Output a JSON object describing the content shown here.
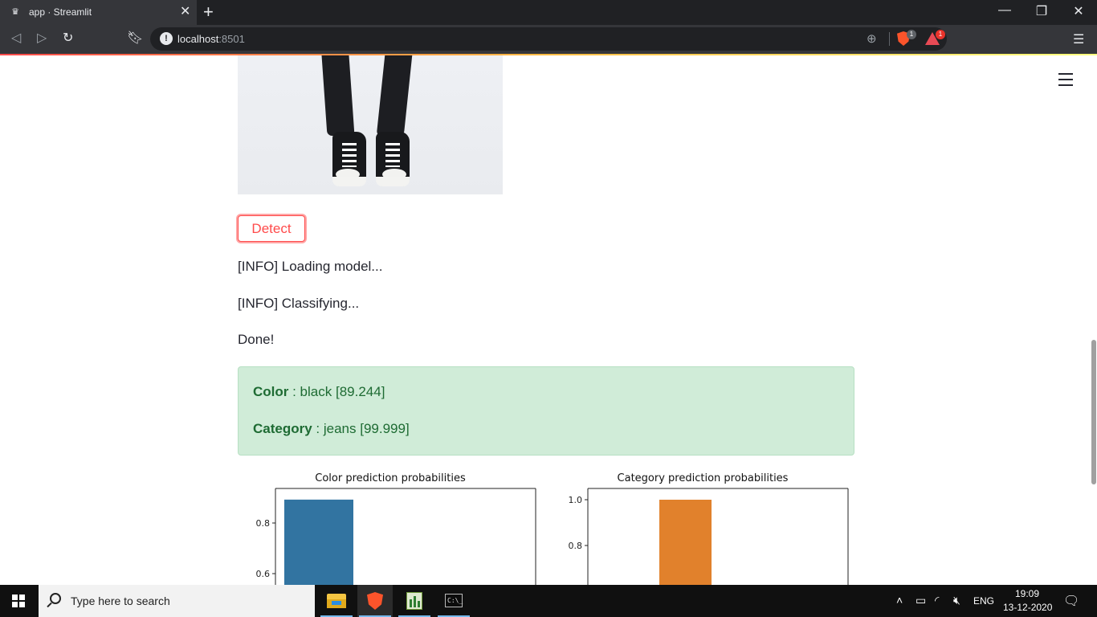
{
  "browser": {
    "tab_title": "app · Streamlit",
    "tab_favicon": "streamlit-crown-icon",
    "url_host": "localhost",
    "url_port": ":8501",
    "shield_badge": "1",
    "rewards_badge": "1"
  },
  "main": {
    "detect_label": "Detect",
    "log": [
      "[INFO] Loading model...",
      "[INFO] Classifying...",
      "Done!"
    ],
    "result": {
      "color_key": "Color",
      "color_value": " : black [89.244]",
      "category_key": "Category",
      "category_value": " : jeans [99.999]"
    }
  },
  "chart_data": [
    {
      "type": "bar",
      "title": "Color prediction probabilities",
      "y_ticks": [
        "0.8",
        "0.6"
      ],
      "values": [
        0.89244
      ],
      "color": "#3274a1"
    },
    {
      "type": "bar",
      "title": "Category prediction probabilities",
      "y_ticks": [
        "1.0",
        "0.8"
      ],
      "values": [
        0.99999
      ],
      "color": "#e1812c"
    }
  ],
  "taskbar": {
    "search_placeholder": "Type here to search",
    "language": "ENG",
    "time": "19:09",
    "date": "13-12-2020"
  },
  "colors": {
    "accent": "#ff4b4b",
    "success_bg": "#d0ecd8",
    "success_text": "#1e6b33"
  }
}
